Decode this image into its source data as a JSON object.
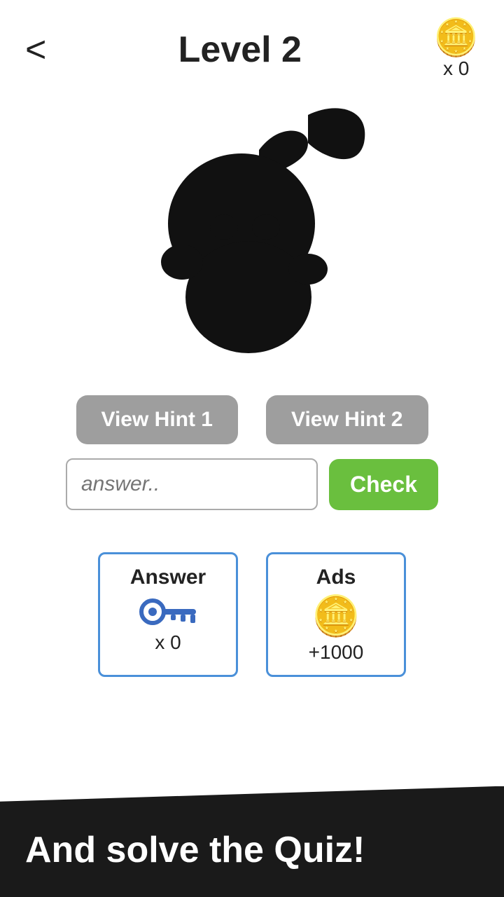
{
  "header": {
    "back_label": "<",
    "title": "Level 2",
    "coins_icon": "🪙",
    "coins_count": "x 0"
  },
  "hints": {
    "hint1_label": "View Hint 1",
    "hint2_label": "View Hint 2"
  },
  "answer": {
    "placeholder": "answer..",
    "check_label": "Check"
  },
  "powerups": {
    "answer_card": {
      "title": "Answer",
      "icon": "key",
      "count": "x 0"
    },
    "ads_card": {
      "title": "Ads",
      "icon": "coins",
      "count": "+1000"
    }
  },
  "banner": {
    "text": "And solve the Quiz!"
  }
}
